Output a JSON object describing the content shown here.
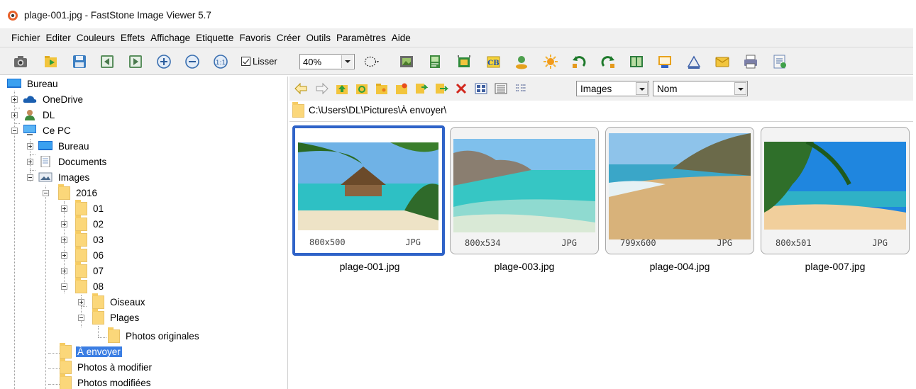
{
  "window": {
    "title": "plage-001.jpg  -  FastStone Image Viewer 5.7"
  },
  "menu": [
    "Fichier",
    "Editer",
    "Couleurs",
    "Effets",
    "Affichage",
    "Etiquette",
    "Favoris",
    "Créer",
    "Outils",
    "Paramètres",
    "Aide"
  ],
  "toolbar": {
    "smooth_label": "Lisser",
    "zoom_value": "40%",
    "icons": [
      "camera-icon",
      "open-folder-icon",
      "save-icon",
      "previous-icon",
      "next-icon",
      "zoom-in-icon",
      "zoom-out-icon",
      "actual-size-icon",
      "select-ellipse-icon",
      "filmstrip-icon",
      "resize-icon",
      "crop-icon",
      "text-icon",
      "user-icon",
      "effects-icon",
      "rotate-left-icon",
      "rotate-right-icon",
      "compare-icon",
      "slideshow-icon",
      "draw-icon",
      "email-icon",
      "print-icon",
      "settings-icon"
    ]
  },
  "tree": {
    "items": [
      {
        "label": "Bureau",
        "icon": "desktop-icon"
      },
      {
        "label": "OneDrive",
        "icon": "cloud-icon"
      },
      {
        "label": "DL",
        "icon": "user-icon"
      },
      {
        "label": "Ce PC",
        "icon": "computer-icon"
      },
      {
        "label": "Bureau",
        "icon": "desktop-icon"
      },
      {
        "label": "Documents",
        "icon": "documents-icon"
      },
      {
        "label": "Images",
        "icon": "images-icon"
      },
      {
        "label": "2016",
        "icon": "folder-icon"
      },
      {
        "label": "01",
        "icon": "folder-icon"
      },
      {
        "label": "02",
        "icon": "folder-icon"
      },
      {
        "label": "03",
        "icon": "folder-icon"
      },
      {
        "label": "06",
        "icon": "folder-icon"
      },
      {
        "label": "07",
        "icon": "folder-icon"
      },
      {
        "label": "08",
        "icon": "folder-icon"
      },
      {
        "label": "Oiseaux",
        "icon": "folder-icon"
      },
      {
        "label": "Plages",
        "icon": "folder-icon"
      },
      {
        "label": "Photos originales",
        "icon": "folder-icon"
      },
      {
        "label": "À envoyer",
        "icon": "folder-icon",
        "selected": true
      },
      {
        "label": "Photos à modifier",
        "icon": "folder-icon"
      },
      {
        "label": "Photos modifiées",
        "icon": "folder-icon"
      }
    ]
  },
  "browser": {
    "filter_value": "Images",
    "sort_value": "Nom",
    "path": "C:\\Users\\DL\\Pictures\\À envoyer\\"
  },
  "thumbnails": [
    {
      "name": "plage-001.jpg",
      "dimensions": "800x500",
      "format": "JPG",
      "selected": true
    },
    {
      "name": "plage-003.jpg",
      "dimensions": "800x534",
      "format": "JPG"
    },
    {
      "name": "plage-004.jpg",
      "dimensions": "799x600",
      "format": "JPG"
    },
    {
      "name": "plage-007.jpg",
      "dimensions": "800x501",
      "format": "JPG"
    }
  ],
  "colors": {
    "selection": "#3b7ee3",
    "thumb_selected_border": "#2f63c8",
    "folder": "#fbd77a"
  }
}
